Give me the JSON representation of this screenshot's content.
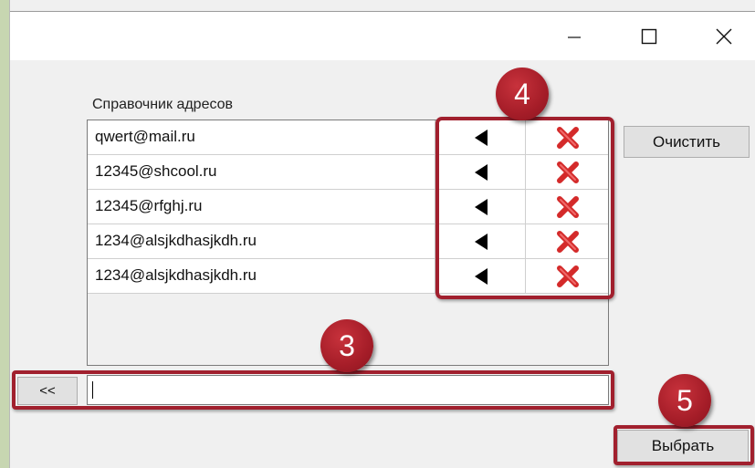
{
  "window": {
    "controls": {
      "minimize": "minimize-icon",
      "maximize": "maximize-icon",
      "close": "close-icon"
    }
  },
  "address_book": {
    "label": "Справочник адресов",
    "entries": [
      {
        "email": "qwert@mail.ru"
      },
      {
        "email": "12345@shcool.ru"
      },
      {
        "email": "12345@rfghj.ru"
      },
      {
        "email": "1234@alsjkdhasjkdh.ru"
      },
      {
        "email": "1234@alsjkdhasjkdh.ru"
      }
    ],
    "row_icons": {
      "move": "left-arrow-icon",
      "delete": "red-x-icon"
    }
  },
  "buttons": {
    "clear": "Очистить",
    "back": "<<",
    "choose": "Выбрать"
  },
  "input": {
    "value": ""
  },
  "annotations": [
    {
      "number": "4"
    },
    {
      "number": "3"
    },
    {
      "number": "5"
    }
  ],
  "colors": {
    "annotation": "#a1202e",
    "delete_icon": "#d42a2a"
  }
}
